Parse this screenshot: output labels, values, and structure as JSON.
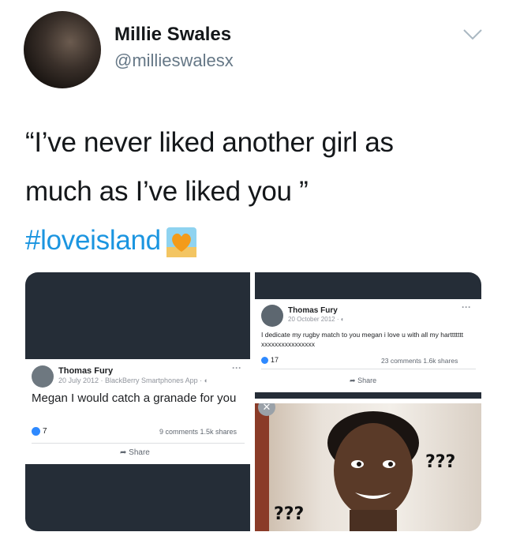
{
  "tweet": {
    "author_name": "Millie Swales",
    "author_handle": "@millieswalesx",
    "text_line1": "“I’ve never liked another girl as",
    "text_line2": "much as I’ve liked you ”",
    "hashtag": "#loveisland"
  },
  "post_left": {
    "name": "Thomas Fury",
    "meta": "20 July 2012 · BlackBerry Smartphones App ·",
    "text": "Megan I would catch a granade for you",
    "likes": "7",
    "stats": "9 comments  1.5k shares",
    "share_label": "Share"
  },
  "post_right": {
    "name": "Thomas Fury",
    "meta": "20 October 2012 ·",
    "text": "I dedicate my rugby match to you megan i love u with all my harttttttt xxxxxxxxxxxxxxxx",
    "likes": "17",
    "stats": "23 comments  1.6k shares",
    "share_label": "Share"
  },
  "meme": {
    "qmarks_top": "???",
    "qmarks_bottom": "???"
  },
  "icons": [
    "chevron-down-icon",
    "heart-emoji-icon",
    "globe-icon",
    "like-icon",
    "share-icon",
    "more-dots-icon",
    "close-icon"
  ],
  "colors": {
    "hashtag": "#1b95e0",
    "handle": "#657786",
    "panel_dark": "#252d37",
    "fb_like": "#2e89ff"
  }
}
